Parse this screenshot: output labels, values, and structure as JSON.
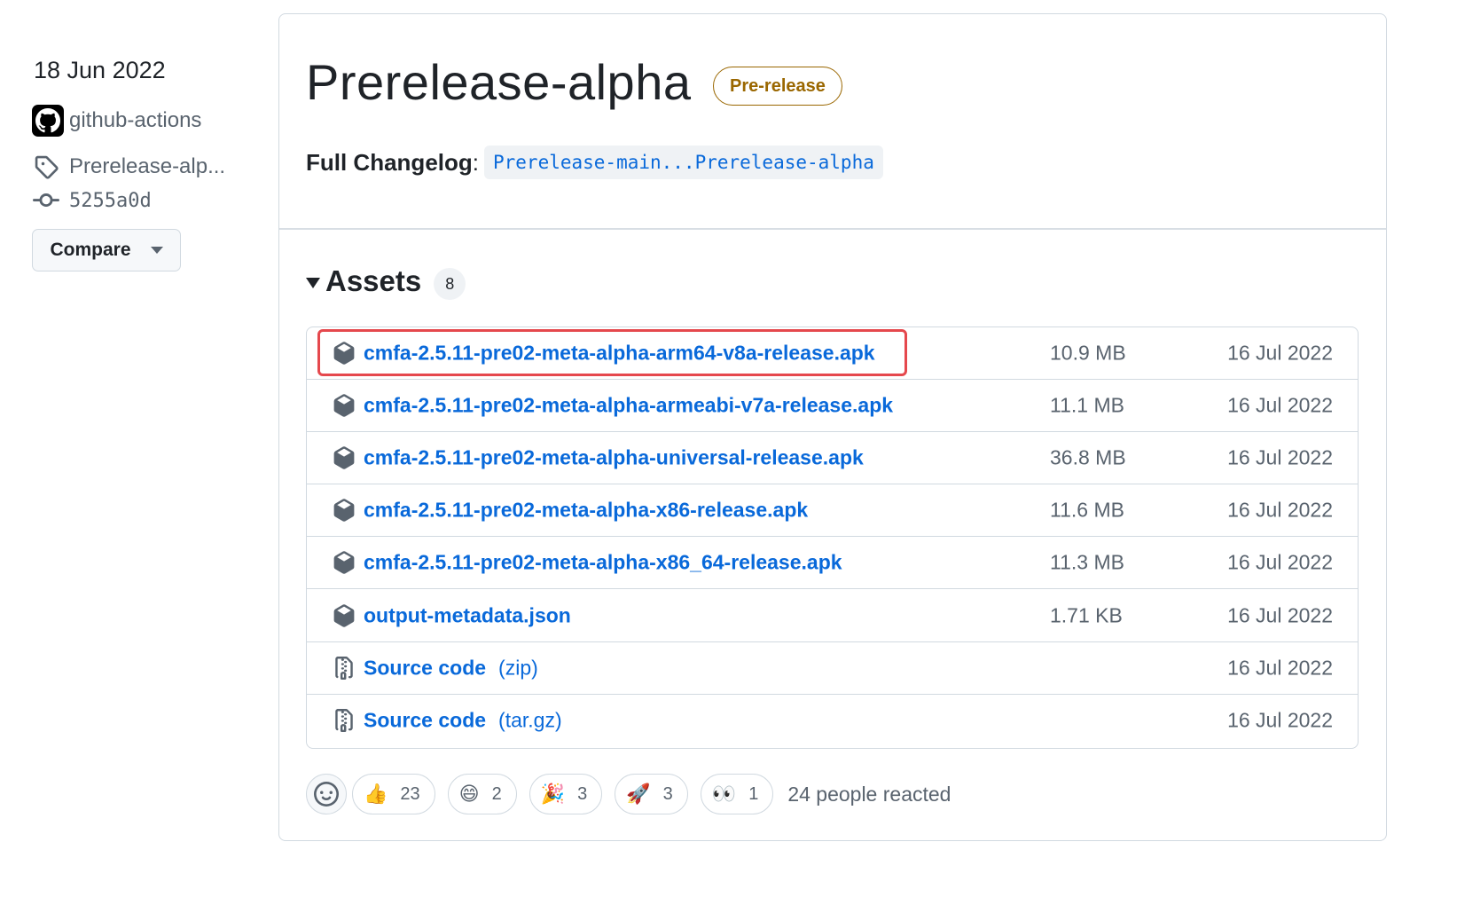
{
  "sidebar": {
    "date": "18 Jun 2022",
    "author": "github-actions",
    "tag": "Prerelease-alp...",
    "commit": "5255a0d",
    "compare_label": "Compare"
  },
  "release": {
    "title": "Prerelease-alpha",
    "badge": "Pre-release",
    "changelog_label": "Full Changelog",
    "changelog_colon": ":",
    "changelog_link": "Prerelease-main...Prerelease-alpha"
  },
  "assets": {
    "title": "Assets",
    "count": "8",
    "items": [
      {
        "name": "cmfa-2.5.11-pre02-meta-alpha-arm64-v8a-release.apk",
        "suffix": "",
        "size": "10.9 MB",
        "date": "16 Jul 2022",
        "icon": "package-icon"
      },
      {
        "name": "cmfa-2.5.11-pre02-meta-alpha-armeabi-v7a-release.apk",
        "suffix": "",
        "size": "11.1 MB",
        "date": "16 Jul 2022",
        "icon": "package-icon"
      },
      {
        "name": "cmfa-2.5.11-pre02-meta-alpha-universal-release.apk",
        "suffix": "",
        "size": "36.8 MB",
        "date": "16 Jul 2022",
        "icon": "package-icon"
      },
      {
        "name": "cmfa-2.5.11-pre02-meta-alpha-x86-release.apk",
        "suffix": "",
        "size": "11.6 MB",
        "date": "16 Jul 2022",
        "icon": "package-icon"
      },
      {
        "name": "cmfa-2.5.11-pre02-meta-alpha-x86_64-release.apk",
        "suffix": "",
        "size": "11.3 MB",
        "date": "16 Jul 2022",
        "icon": "package-icon"
      },
      {
        "name": "output-metadata.json",
        "suffix": "",
        "size": "1.71 KB",
        "date": "16 Jul 2022",
        "icon": "package-icon"
      },
      {
        "name": "Source code",
        "suffix": "(zip)",
        "size": "",
        "date": "16 Jul 2022",
        "icon": "file-zip-icon"
      },
      {
        "name": "Source code",
        "suffix": "(tar.gz)",
        "size": "",
        "date": "16 Jul 2022",
        "icon": "file-zip-icon"
      }
    ]
  },
  "reactions": {
    "items": [
      {
        "emoji": "👍",
        "count": "23",
        "name": "thumbs-up"
      },
      {
        "emoji": "😄",
        "count": "2",
        "name": "laugh"
      },
      {
        "emoji": "🎉",
        "count": "3",
        "name": "hooray"
      },
      {
        "emoji": "🚀",
        "count": "3",
        "name": "rocket"
      },
      {
        "emoji": "👀",
        "count": "1",
        "name": "eyes"
      }
    ],
    "summary": "24 people reacted"
  },
  "colors": {
    "link": "#0969da",
    "prerelease": "#9a6700",
    "highlight": "#e5484d",
    "muted": "#59636e"
  }
}
